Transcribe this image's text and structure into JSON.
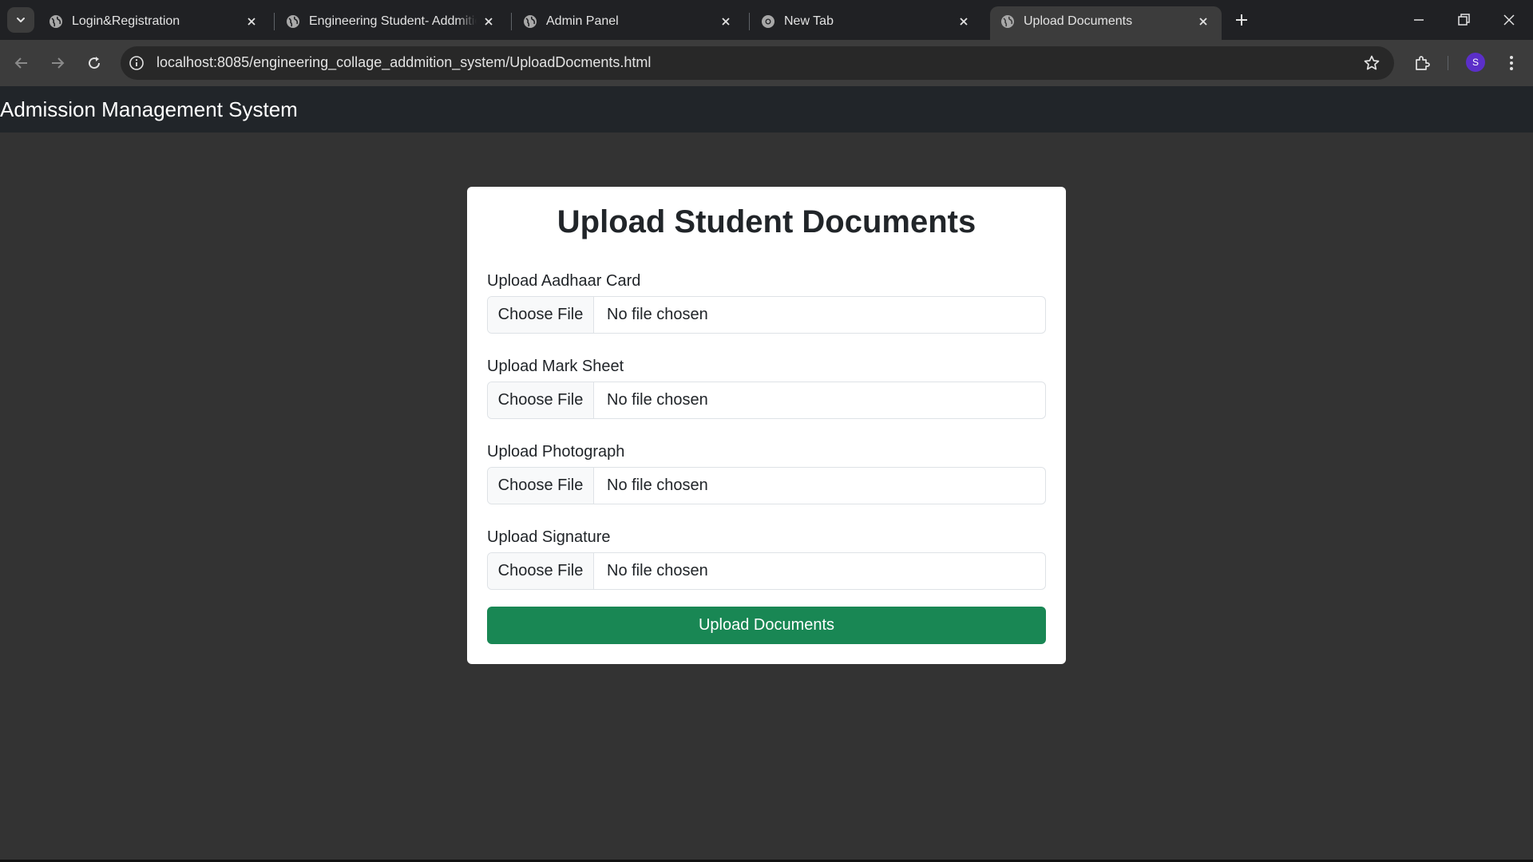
{
  "browser": {
    "tabs": [
      {
        "title": "Login&Registration",
        "active": false
      },
      {
        "title": "Engineering Student- Addmition",
        "active": false
      },
      {
        "title": "Admin Panel",
        "active": false
      },
      {
        "title": "New Tab",
        "active": false
      },
      {
        "title": "Upload Documents",
        "active": true
      }
    ],
    "url": "localhost:8085/engineering_collage_addmition_system/UploadDocments.html",
    "profile_initial": "S",
    "profile_color": "#5b2fc9"
  },
  "navbar": {
    "brand": "Admission Management System"
  },
  "form": {
    "title": "Upload Student Documents",
    "fields": [
      {
        "label": "Upload Aadhaar Card",
        "button": "Choose File",
        "status": "No file chosen"
      },
      {
        "label": "Upload Mark Sheet",
        "button": "Choose File",
        "status": "No file chosen"
      },
      {
        "label": "Upload Photograph",
        "button": "Choose File",
        "status": "No file chosen"
      },
      {
        "label": "Upload Signature",
        "button": "Choose File",
        "status": "No file chosen"
      }
    ],
    "submit_label": "Upload Documents",
    "submit_color": "#198754"
  }
}
